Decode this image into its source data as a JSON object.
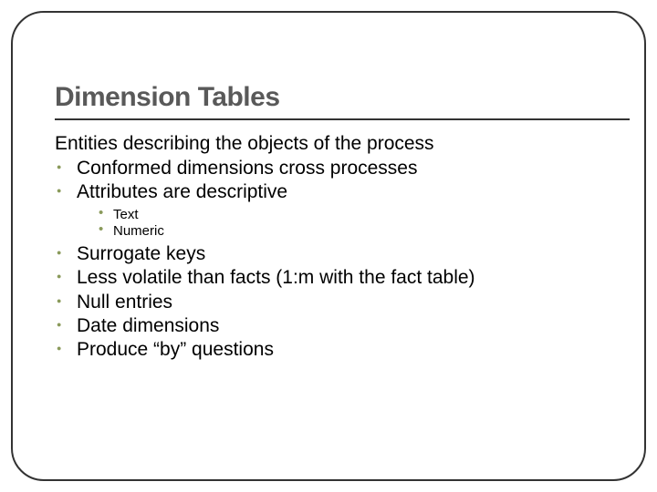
{
  "slide": {
    "title": "Dimension Tables",
    "intro": "Entities describing the objects of the process",
    "bullets": {
      "b0": "Conformed dimensions cross processes",
      "b1": "Attributes are descriptive",
      "b1_sub": {
        "s0": "Text",
        "s1": "Numeric"
      },
      "b2": "Surrogate keys",
      "b3": "Less volatile than facts (1:m with the fact table)",
      "b4": "Null entries",
      "b5": "Date dimensions",
      "b6": "Produce “by” questions"
    }
  }
}
